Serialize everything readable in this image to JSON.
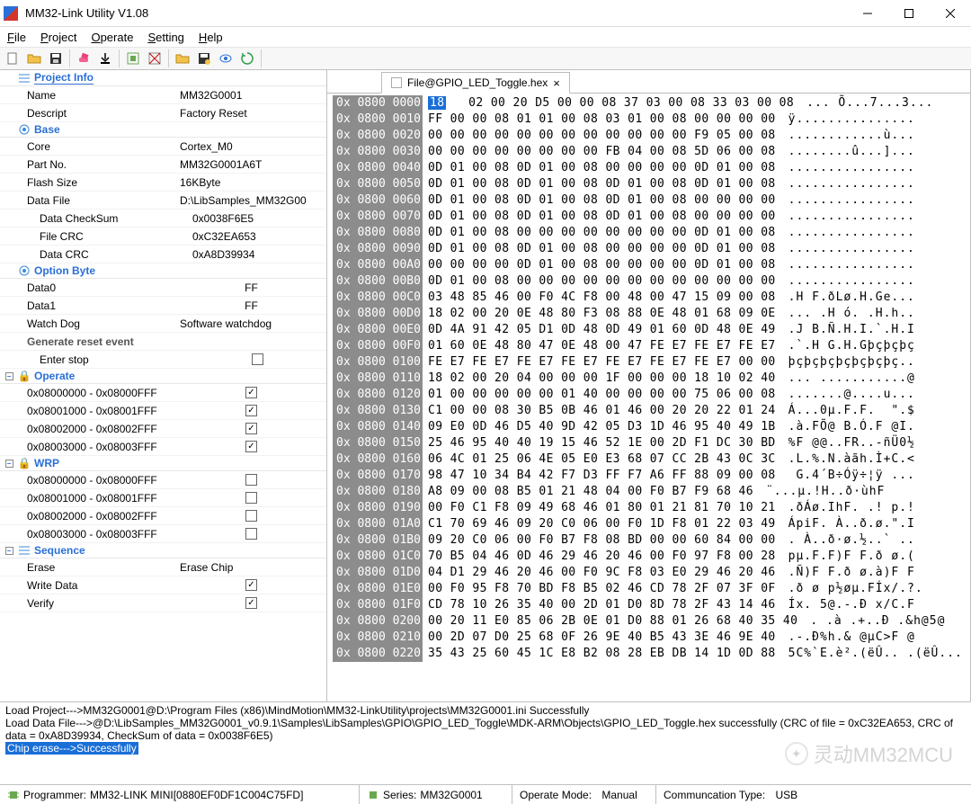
{
  "window": {
    "title": "MM32-Link Utility V1.08"
  },
  "menu": {
    "items": [
      "File",
      "Project",
      "Operate",
      "Setting",
      "Help"
    ]
  },
  "toolbar_icons": [
    "new",
    "open",
    "save",
    "erase",
    "download",
    "connect1",
    "connect2",
    "folder-open",
    "db",
    "eye",
    "refresh"
  ],
  "project_info": {
    "header": "Project Info",
    "name_label": "Name",
    "name": "MM32G0001",
    "descript_label": "Descript",
    "descript": "Factory Reset"
  },
  "base": {
    "header": "Base",
    "core_label": "Core",
    "core": "Cortex_M0",
    "partno_label": "Part No.",
    "partno": "MM32G0001A6T",
    "flash_label": "Flash Size",
    "flash": "16KByte",
    "datafile_label": "Data File",
    "datafile": "D:\\LibSamples_MM32G00",
    "checksum_label": "Data CheckSum",
    "checksum": "0x0038F6E5",
    "filecrc_label": "File CRC",
    "filecrc": "0xC32EA653",
    "datacrc_label": "Data CRC",
    "datacrc": "0xA8D39934"
  },
  "option_byte": {
    "header": "Option Byte",
    "data0_label": "Data0",
    "data0": "FF",
    "data1_label": "Data1",
    "data1": "FF",
    "wdg_label": "Watch Dog",
    "wdg": "Software watchdog",
    "genreset_label": "Generate reset event",
    "enterstop_label": "Enter stop"
  },
  "operate": {
    "header": "Operate",
    "ranges": [
      {
        "label": "0x08000000 - 0x08000FFF",
        "checked": true
      },
      {
        "label": "0x08001000 - 0x08001FFF",
        "checked": true
      },
      {
        "label": "0x08002000 - 0x08002FFF",
        "checked": true
      },
      {
        "label": "0x08003000 - 0x08003FFF",
        "checked": true
      }
    ]
  },
  "wrp": {
    "header": "WRP",
    "ranges": [
      {
        "label": "0x08000000 - 0x08000FFF",
        "checked": false
      },
      {
        "label": "0x08001000 - 0x08001FFF",
        "checked": false
      },
      {
        "label": "0x08002000 - 0x08002FFF",
        "checked": false
      },
      {
        "label": "0x08003000 - 0x08003FFF",
        "checked": false
      }
    ]
  },
  "sequence": {
    "header": "Sequence",
    "erase_label": "Erase",
    "erase_val": "Erase Chip",
    "write_label": "Write Data",
    "write_checked": true,
    "verify_label": "Verify",
    "verify_checked": true
  },
  "tab": {
    "label": "File@GPIO_LED_Toggle.hex"
  },
  "hex_first_byte": "18",
  "hex_rows": [
    {
      "addr": "0x 0800 0000",
      "bytes": "   02 00 20 D5 00 00 08 37 03 00 08 33 03 00 08",
      "ascii": "... Õ...7...3..."
    },
    {
      "addr": "0x 0800 0010",
      "bytes": "FF 00 00 08 01 01 00 08 03 01 00 08 00 00 00 00",
      "ascii": "ÿ..............."
    },
    {
      "addr": "0x 0800 0020",
      "bytes": "00 00 00 00 00 00 00 00 00 00 00 00 F9 05 00 08",
      "ascii": "............ù..."
    },
    {
      "addr": "0x 0800 0030",
      "bytes": "00 00 00 00 00 00 00 00 FB 04 00 08 5D 06 00 08",
      "ascii": "........û...]..."
    },
    {
      "addr": "0x 0800 0040",
      "bytes": "0D 01 00 08 0D 01 00 08 00 00 00 00 0D 01 00 08",
      "ascii": "................"
    },
    {
      "addr": "0x 0800 0050",
      "bytes": "0D 01 00 08 0D 01 00 08 0D 01 00 08 0D 01 00 08",
      "ascii": "................"
    },
    {
      "addr": "0x 0800 0060",
      "bytes": "0D 01 00 08 0D 01 00 08 0D 01 00 08 00 00 00 00",
      "ascii": "................"
    },
    {
      "addr": "0x 0800 0070",
      "bytes": "0D 01 00 08 0D 01 00 08 0D 01 00 08 00 00 00 00",
      "ascii": "................"
    },
    {
      "addr": "0x 0800 0080",
      "bytes": "0D 01 00 08 00 00 00 00 00 00 00 00 0D 01 00 08",
      "ascii": "................"
    },
    {
      "addr": "0x 0800 0090",
      "bytes": "0D 01 00 08 0D 01 00 08 00 00 00 00 0D 01 00 08",
      "ascii": "................"
    },
    {
      "addr": "0x 0800 00A0",
      "bytes": "00 00 00 00 0D 01 00 08 00 00 00 00 0D 01 00 08",
      "ascii": "................"
    },
    {
      "addr": "0x 0800 00B0",
      "bytes": "0D 01 00 08 00 00 00 00 00 00 00 00 00 00 00 00",
      "ascii": "................"
    },
    {
      "addr": "0x 0800 00C0",
      "bytes": "03 48 85 46 00 F0 4C F8 00 48 00 47 15 09 00 08",
      "ascii": ".H F.ðLø.H.Ge..."
    },
    {
      "addr": "0x 0800 00D0",
      "bytes": "18 02 00 20 0E 48 80 F3 08 88 0E 48 01 68 09 0E",
      "ascii": "... .H ó. .H.h.."
    },
    {
      "addr": "0x 0800 00E0",
      "bytes": "0D 4A 91 42 05 D1 0D 48 0D 49 01 60 0D 48 0E 49",
      "ascii": ".J B.Ñ.H.I.`.H.I"
    },
    {
      "addr": "0x 0800 00F0",
      "bytes": "01 60 0E 48 80 47 0E 48 00 47 FE E7 FE E7 FE E7",
      "ascii": ".`.H G.H.Gþçþçþç"
    },
    {
      "addr": "0x 0800 0100",
      "bytes": "FE E7 FE E7 FE E7 FE E7 FE E7 FE E7 FE E7 00 00",
      "ascii": "þçþçþçþçþçþçþç.."
    },
    {
      "addr": "0x 0800 0110",
      "bytes": "18 02 00 20 04 00 00 00 1F 00 00 00 18 10 02 40",
      "ascii": "... ...........@"
    },
    {
      "addr": "0x 0800 0120",
      "bytes": "01 00 00 00 00 00 01 40 00 00 00 00 75 06 00 08",
      "ascii": ".......@....u..."
    },
    {
      "addr": "0x 0800 0130",
      "bytes": "C1 00 00 08 30 B5 0B 46 01 46 00 20 20 22 01 24",
      "ascii": "Á...0µ.F.F.  \".$"
    },
    {
      "addr": "0x 0800 0140",
      "bytes": "09 E0 0D 46 D5 40 9D 42 05 D3 1D 46 95 40 49 1B",
      "ascii": ".à.FÕ@ B.Ó.F @I."
    },
    {
      "addr": "0x 0800 0150",
      "bytes": "25 46 95 40 40 19 15 46 52 1E 00 2D F1 DC 30 BD",
      "ascii": "%F @@..FR..-ñÜ0½"
    },
    {
      "addr": "0x 0800 0160",
      "bytes": "06 4C 01 25 06 4E 05 E0 E3 68 07 CC 2B 43 0C 3C",
      "ascii": ".L.%.N.àãh.Ì+C.<"
    },
    {
      "addr": "0x 0800 0170",
      "bytes": "98 47 10 34 B4 42 F7 D3 FF F7 A6 FF 88 09 00 08",
      "ascii": " G.4´B÷Óÿ÷¦ÿ ..."
    },
    {
      "addr": "0x 0800 0180",
      "bytes": "A8 09 00 08 B5 01 21 48 04 00 F0 B7 F9 68 46",
      "ascii": "¨...µ.!H..ð·ùhF"
    },
    {
      "addr": "0x 0800 0190",
      "bytes": "00 F0 C1 F8 09 49 68 46 01 80 01 21 81 70 10 21",
      "ascii": ".ðÁø.IhF. .! p.!"
    },
    {
      "addr": "0x 0800 01A0",
      "bytes": "C1 70 69 46 09 20 C0 06 00 F0 1D F8 01 22 03 49",
      "ascii": "ÁpiF. À..ð.ø.\".I"
    },
    {
      "addr": "0x 0800 01B0",
      "bytes": "09 20 C0 06 00 F0 B7 F8 08 BD 00 00 60 84 00 00",
      "ascii": ". À..ð·ø.½..` .."
    },
    {
      "addr": "0x 0800 01C0",
      "bytes": "70 B5 04 46 0D 46 29 46 20 46 00 F0 97 F8 00 28",
      "ascii": "pµ.F.F)F F.ð ø.("
    },
    {
      "addr": "0x 0800 01D0",
      "bytes": "04 D1 29 46 20 46 00 F0 9C F8 03 E0 29 46 20 46",
      "ascii": ".Ñ)F F.ð ø.à)F F"
    },
    {
      "addr": "0x 0800 01E0",
      "bytes": "00 F0 95 F8 70 BD F8 B5 02 46 CD 78 2F 07 3F 0F",
      "ascii": ".ð ø p½øµ.FÍx/.?."
    },
    {
      "addr": "0x 0800 01F0",
      "bytes": "CD 78 10 26 35 40 00 2D 01 D0 8D 78 2F 43 14 46",
      "ascii": "Íx. 5@.-.Ð x/C.F"
    },
    {
      "addr": "0x 0800 0200",
      "bytes": "00 20 11 E0 85 06 2B 0E 01 D0 88 01 26 68 40 35 40",
      "ascii": ". .à .+..Ð .&h@5@"
    },
    {
      "addr": "0x 0800 0210",
      "bytes": "00 2D 07 D0 25 68 0F 26 9E 40 B5 43 3E 46 9E 40",
      "ascii": ".-.Ð%h.& @µC>F @"
    },
    {
      "addr": "0x 0800 0220",
      "bytes": "35 43 25 60 45 1C E8 B2 08 28 EB DB 14 1D 0D 88",
      "ascii": "5C%`E.è².(ëÛ.. .(ëÛ..."
    }
  ],
  "log": {
    "line1": "Load Project--->MM32G0001@D:\\Program Files (x86)\\MindMotion\\MM32-LinkUtility\\projects\\MM32G0001.ini Successfully",
    "line2": "Load Data File--->@D:\\LibSamples_MM32G0001_v0.9.1\\Samples\\LibSamples\\GPIO\\GPIO_LED_Toggle\\MDK-ARM\\Objects\\GPIO_LED_Toggle.hex  successfully (CRC of file = 0xC32EA653, CRC of data = 0xA8D39934, CheckSum of data = 0x0038F6E5)",
    "line3": "Chip erase--->Successfully"
  },
  "status": {
    "programmer_label": "Programmer:",
    "programmer": "MM32-LINK MINI[0880EF0DF1C004C75FD]",
    "series_label": "Series:",
    "series": "MM32G0001",
    "mode_label": "Operate Mode:",
    "mode": "Manual",
    "comm_label": "Communcation Type:",
    "comm": "USB"
  },
  "watermark": "灵动MM32MCU"
}
